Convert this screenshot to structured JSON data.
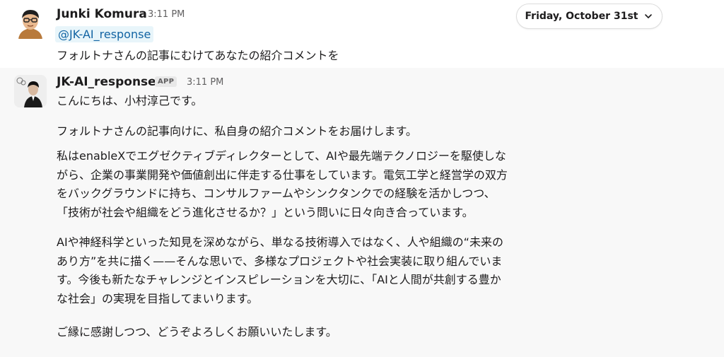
{
  "date_divider": {
    "label": "Friday, October 31st",
    "icon": "chevron-down-icon"
  },
  "messages": [
    {
      "sender": "Junki Komura",
      "time": "3:11 PM",
      "mention": "@JK-AI_response",
      "text": "フォルトナさんの記事にむけてあなたの紹介コメントを"
    },
    {
      "sender": "JK-AI_response",
      "badge": "APP",
      "time": "3:11 PM",
      "paragraphs": [
        [
          "こんにちは、小村淳己です。"
        ],
        [
          "フォルトナさんの記事向けに、私自身の紹介コメントをお届けします。"
        ],
        [
          "私はenableXでエグゼクティブディレクターとして、AIや最先端テクノロジーを駆使しな",
          "がら、企業の事業開発や価値創出に伴走する仕事をしています。電気工学と経営学の双方",
          "をバックグラウンドに持ち、コンサルファームやシンクタンクでの経験を活かしつつ、",
          "「技術が社会や組織をどう進化させるか？」という問いに日々向き合っています。"
        ],
        [
          "AIや神経科学といった知見を深めながら、単なる技術導入ではなく、人や組織の“未来の",
          "あり方”を共に描く——そんな思いで、多様なプロジェクトや社会実装に取り組んでいま",
          "す。今後も新たなチャレンジとインスピレーションを大切に、「AIと人間が共創する豊か",
          "な社会」の実現を目指してまいります。"
        ],
        [
          "ご縁に感謝しつつ、どうぞよろしくお願いいたします。"
        ]
      ]
    }
  ]
}
